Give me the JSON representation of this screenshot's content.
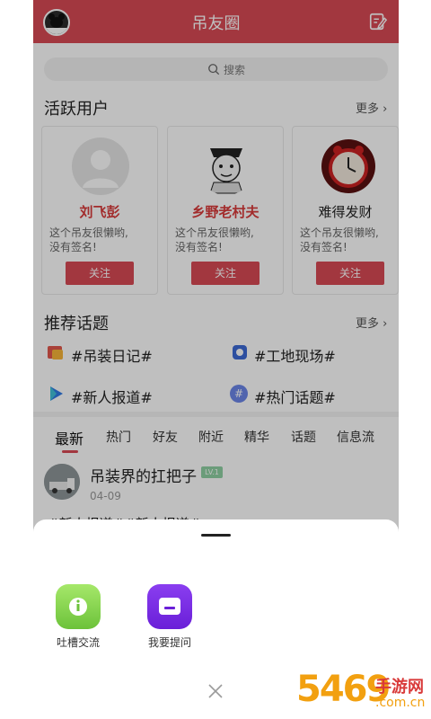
{
  "header": {
    "title": "吊友圈",
    "accent": "#d94a55"
  },
  "search": {
    "placeholder": "搜索"
  },
  "active_users": {
    "title": "活跃用户",
    "more": "更多",
    "users": [
      {
        "name": "刘飞彭",
        "sign_line1": "这个吊友很懒哟,",
        "sign_line2": "没有签名!",
        "follow": "关注"
      },
      {
        "name": "乡野老村夫",
        "sign_line1": "这个吊友很懒哟,",
        "sign_line2": "没有签名!",
        "follow": "关注"
      },
      {
        "name": "难得发财",
        "sign_line1": "这个吊友很懒哟,",
        "sign_line2": "没有签名!",
        "follow": "关注"
      }
    ]
  },
  "topics": {
    "title": "推荐话题",
    "more": "更多",
    "items": [
      "#吊装日记#",
      "#工地现场#",
      "#新人报道#",
      "#热门话题#"
    ]
  },
  "tabs": [
    "最新",
    "热门",
    "好友",
    "附近",
    "精华",
    "话题",
    "信息流"
  ],
  "post": {
    "title": "吊装界的扛把子",
    "badge": "LV.1",
    "date": "04-09",
    "peek": "#新人报道##新人报道#"
  },
  "sheet": {
    "actions": [
      {
        "label": "吐槽交流",
        "color": "#8cd94f"
      },
      {
        "label": "我要提问",
        "color": "#7a2ee6"
      }
    ]
  },
  "watermark": {
    "main": "5469",
    "sub": "手游网",
    "url": ".com.cn"
  }
}
